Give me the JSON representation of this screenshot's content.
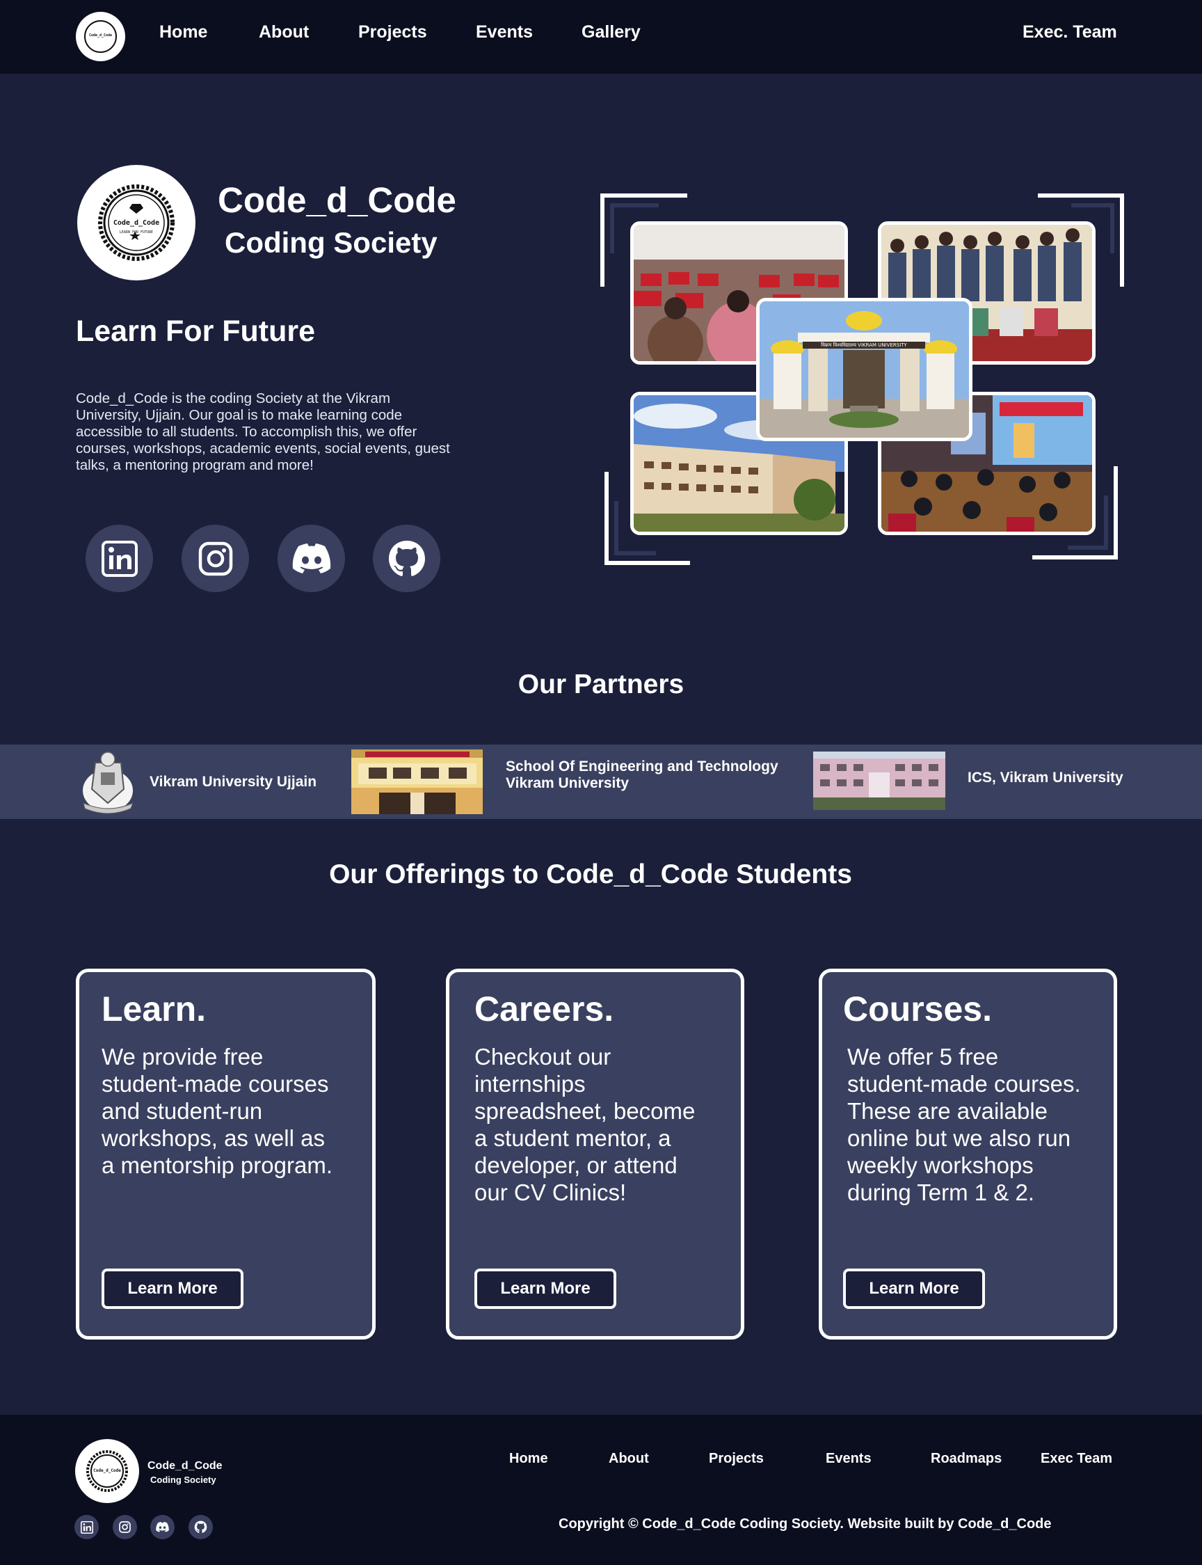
{
  "nav": {
    "logo_icon": "code-d-code-badge",
    "links": [
      "Home",
      "About",
      "Projects",
      "Events",
      "Gallery"
    ],
    "exec_team": "Exec. Team"
  },
  "logo": {
    "wordmark": "Code_d_Code",
    "motto": "LEARN FOR FUTURE"
  },
  "hero": {
    "title": "Code_d_Code",
    "subtitle": "Coding Society",
    "tagline": "Learn For Future",
    "description": "Code_d_Code is the coding Society at the Vikram University, Ujjain. Our goal is to make learning code accessible to all students. To accomplish this, we offer courses, workshops, academic events, social events, guest talks, a mentoring program and more!",
    "social_icons": [
      "linkedin-icon",
      "instagram-icon",
      "discord-icon",
      "github-icon"
    ],
    "collage": {
      "photos": [
        "auditorium-audience",
        "group-photo",
        "university-gate",
        "campus-building",
        "seminar-hall"
      ],
      "gate_sign": "विक्रम विश्वविद्यालय  VIKRAM UNIVERSITY"
    }
  },
  "partners": {
    "title": "Our Partners",
    "items": [
      {
        "name": "Vikram University Ujjain",
        "image": "university-emblem"
      },
      {
        "name_line1": "School Of Engineering and Technology",
        "name_line2": "Vikram University",
        "image": "engineering-building"
      },
      {
        "name": "ICS, Vikram University",
        "image": "ics-building"
      }
    ]
  },
  "offerings": {
    "title": "Our Offerings to Code_d_Code Students",
    "cards": [
      {
        "title": "Learn.",
        "body": "We provide free student-made courses and student-run workshops, as well as a mentorship program.",
        "button": "Learn More"
      },
      {
        "title": "Careers.",
        "body": "Checkout our internships spreadsheet, become a student mentor, a developer, or attend our CV Clinics!",
        "button": "Learn More"
      },
      {
        "title": "Courses.",
        "body": "We offer 5 free student-made courses. These are available online but we also run weekly workshops during Term 1 & 2.",
        "button": "Learn More"
      }
    ]
  },
  "footer": {
    "name": "Code_d_Code",
    "sub": "Coding Society",
    "links": [
      "Home",
      "About",
      "Projects",
      "Events",
      "Roadmaps",
      "Exec Team"
    ],
    "copyright": "Copyright © Code_d_Code  Coding Society. Website built by Code_d_Code"
  },
  "colors": {
    "background": "#1b1f3a",
    "nav_bg": "#0b0e1f",
    "card_bg": "#3a405f",
    "icon_circle": "#3a3f5f",
    "text": "#ffffff"
  }
}
